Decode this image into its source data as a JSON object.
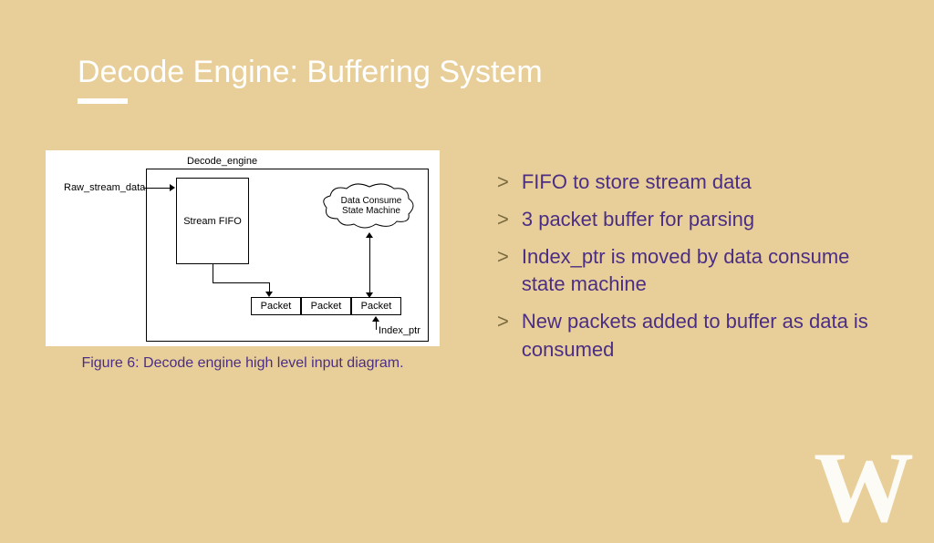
{
  "title": "Decode Engine: Buffering System",
  "diagram": {
    "caption": "Figure 6: Decode engine high level input diagram.",
    "labels": {
      "raw_stream": "Raw_stream_data",
      "decode_engine": "Decode_engine",
      "stream_fifo": "Stream FIFO",
      "state_machine": "Data Consume State Machine",
      "packet": "Packet",
      "index_ptr": "Index_ptr"
    }
  },
  "bullets": [
    "FIFO to store stream data",
    "3 packet buffer for parsing",
    "Index_ptr is moved by data consume state machine",
    "New packets added to buffer as data is consumed"
  ],
  "logo_text": "W"
}
